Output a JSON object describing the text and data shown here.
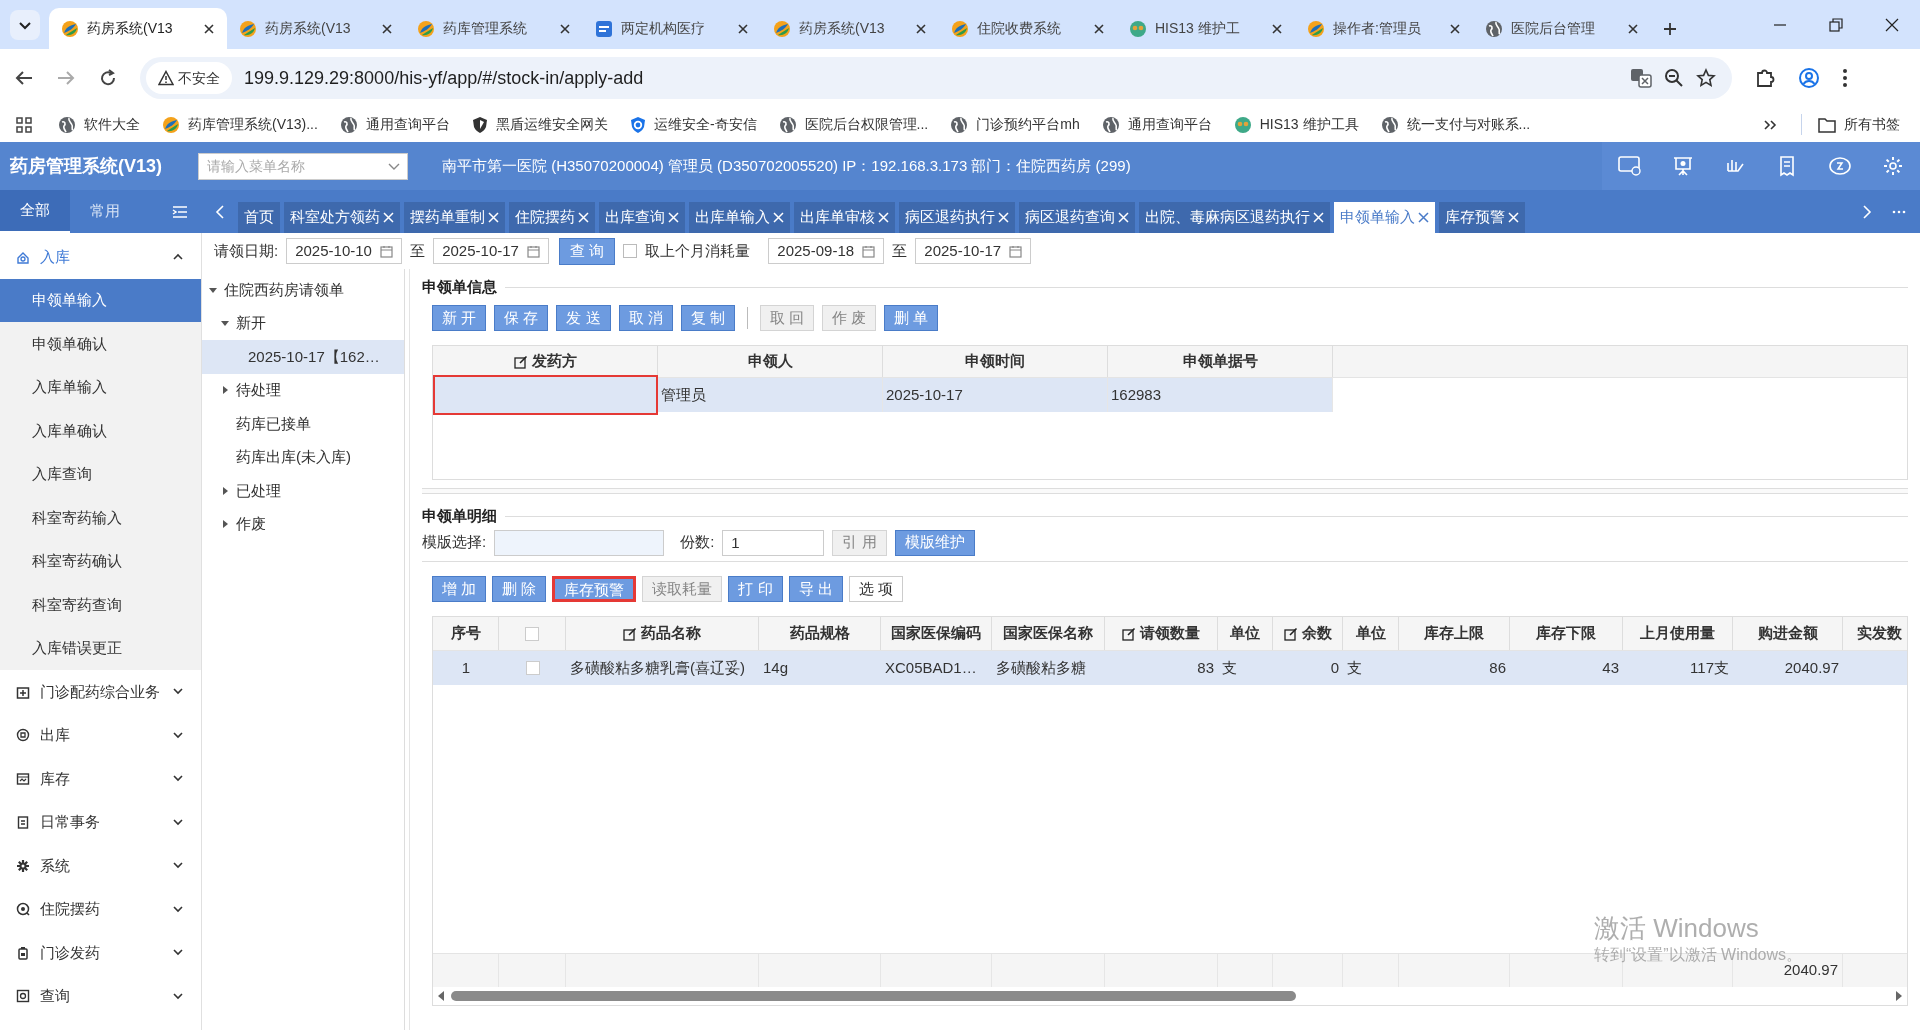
{
  "browser": {
    "tabs": [
      {
        "title": "药房系统(V13",
        "kind": "swirl",
        "selected": true
      },
      {
        "title": "药房系统(V13",
        "kind": "swirl",
        "selected": false
      },
      {
        "title": "药库管理系统",
        "kind": "swirl",
        "selected": false
      },
      {
        "title": "两定机构医疗",
        "kind": "chs",
        "selected": false
      },
      {
        "title": "药房系统(V13",
        "kind": "swirl",
        "selected": false
      },
      {
        "title": "住院收费系统",
        "kind": "swirl",
        "selected": false
      },
      {
        "title": "HIS13 维护工",
        "kind": "his",
        "selected": false
      },
      {
        "title": "操作者:管理员",
        "kind": "swirl",
        "selected": false
      },
      {
        "title": "医院后台管理",
        "kind": "globe",
        "selected": false
      }
    ],
    "security": "不安全",
    "url": "199.9.129.29:8000/his-yf/app/#/stock-in/apply-add",
    "bookmarks": [
      {
        "label": "软件大全",
        "kind": "globe"
      },
      {
        "label": "药库管理系统(V13)...",
        "kind": "swirl"
      },
      {
        "label": "通用查询平台",
        "kind": "globe"
      },
      {
        "label": "黑盾运维安全网关",
        "kind": "shield-dark"
      },
      {
        "label": "运维安全-奇安信",
        "kind": "shield"
      },
      {
        "label": "医院后台权限管理...",
        "kind": "globe"
      },
      {
        "label": "门诊预约平台mh",
        "kind": "globe"
      },
      {
        "label": "通用查询平台",
        "kind": "globe"
      },
      {
        "label": "HIS13 维护工具",
        "kind": "his"
      },
      {
        "label": "统一支付与对账系...",
        "kind": "globe"
      }
    ],
    "all_bookmarks": "所有书签"
  },
  "app": {
    "title": "药房管理系统(V13)",
    "menu_search": {
      "placeholder": "请输入菜单名称"
    },
    "info": "南平市第一医院 (H35070200004) 管理员 (D350702005520) IP：192.168.3.173 部门：住院西药房 (299)"
  },
  "sidebar": {
    "tabs": [
      {
        "label": "全部",
        "selected": true
      },
      {
        "label": "常用",
        "selected": false
      }
    ],
    "groups": [
      {
        "label": "入库",
        "kind": "inbox",
        "expanded": true,
        "children": [
          {
            "label": "申领单输入",
            "selected": true
          },
          {
            "label": "申领单确认",
            "selected": false
          },
          {
            "label": "入库单输入",
            "selected": false
          },
          {
            "label": "入库单确认",
            "selected": false
          },
          {
            "label": "入库查询",
            "selected": false
          },
          {
            "label": "科室寄药输入",
            "selected": false
          },
          {
            "label": "科室寄药确认",
            "selected": false
          },
          {
            "label": "科室寄药查询",
            "selected": false
          },
          {
            "label": "入库错误更正",
            "selected": false
          }
        ]
      },
      {
        "label": "门诊配药综合业务",
        "kind": "clinic",
        "expanded": false
      },
      {
        "label": "出库",
        "kind": "outbox",
        "expanded": false
      },
      {
        "label": "库存",
        "kind": "stock",
        "expanded": false
      },
      {
        "label": "日常事务",
        "kind": "daily",
        "expanded": false
      },
      {
        "label": "系统",
        "kind": "gear",
        "expanded": false
      },
      {
        "label": "住院摆药",
        "kind": "ward",
        "expanded": false
      },
      {
        "label": "门诊发药",
        "kind": "dispense",
        "expanded": false
      },
      {
        "label": "查询",
        "kind": "query",
        "expanded": false
      }
    ]
  },
  "page_tabs": [
    {
      "label": "首页",
      "closable": false,
      "selected": false
    },
    {
      "label": "科室处方领药",
      "closable": true,
      "selected": false
    },
    {
      "label": "摆药单重制",
      "closable": true,
      "selected": false
    },
    {
      "label": "住院摆药",
      "closable": true,
      "selected": false
    },
    {
      "label": "出库查询",
      "closable": true,
      "selected": false
    },
    {
      "label": "出库单输入",
      "closable": true,
      "selected": false
    },
    {
      "label": "出库单审核",
      "closable": true,
      "selected": false
    },
    {
      "label": "病区退药执行",
      "closable": true,
      "selected": false
    },
    {
      "label": "病区退药查询",
      "closable": true,
      "selected": false
    },
    {
      "label": "出院、毒麻病区退药执行",
      "closable": true,
      "selected": false
    },
    {
      "label": "申领单输入",
      "closable": true,
      "selected": true
    },
    {
      "label": "库存预警",
      "closable": true,
      "selected": false
    }
  ],
  "filter": {
    "label": "请领日期:",
    "from": "2025-10-10",
    "to_label": "至",
    "to": "2025-10-17",
    "query": "查 询",
    "checkbox": {
      "label": "取上个月消耗量",
      "checked": false
    },
    "from2": "2025-09-18",
    "to_label2": "至",
    "to2": "2025-10-17"
  },
  "tree": [
    {
      "label": "住院西药房请领单",
      "expanded": true,
      "selected": false,
      "children": [
        {
          "label": "新开",
          "expanded": true,
          "selected": false,
          "children": [
            {
              "label": "2025-10-17【162…",
              "selected": true
            }
          ]
        },
        {
          "label": "待处理",
          "expanded": false,
          "selected": false
        },
        {
          "label": "药库已接单",
          "selected": false
        },
        {
          "label": "药库出库(未入库)",
          "selected": false
        },
        {
          "label": "已处理",
          "expanded": false,
          "selected": false
        },
        {
          "label": "作废",
          "expanded": false,
          "selected": false
        }
      ]
    }
  ],
  "info_section": {
    "title": "申领单信息",
    "button_groups": [
      [
        {
          "label": "新 开",
          "disabled": false
        },
        {
          "label": "保 存",
          "disabled": false
        },
        {
          "label": "发 送",
          "disabled": false
        },
        {
          "label": "取 消",
          "disabled": false
        },
        {
          "label": "复 制",
          "disabled": false
        }
      ],
      [
        {
          "label": "取 回",
          "disabled": true
        },
        {
          "label": "作 废",
          "disabled": true
        },
        {
          "label": "删 单",
          "disabled": false
        }
      ]
    ],
    "table": {
      "columns": [
        {
          "label": "发药方",
          "editable": true
        },
        {
          "label": "申领人",
          "editable": false
        },
        {
          "label": "申领时间",
          "editable": false
        },
        {
          "label": "申领单据号",
          "editable": false
        }
      ],
      "rows": [
        {
          "selected": true,
          "cells": [
            {
              "highlighted": true
            },
            {
              "text": "管理员",
              "highlighted": false
            },
            {
              "text": "2025-10-17",
              "highlighted": false
            },
            {
              "text": "162983",
              "highlighted": false
            }
          ]
        }
      ]
    }
  },
  "detail_section": {
    "title": "申领单明细",
    "template": {
      "label": "模版选择:"
    },
    "copies": {
      "label": "份数:",
      "value": "1"
    },
    "template_buttons": [
      {
        "label": "引 用",
        "disabled": true,
        "highlighted": false
      },
      {
        "label": "模版维护",
        "disabled": false,
        "highlighted": false
      }
    ],
    "toolbar": [
      {
        "label": "增 加",
        "kind": "normal",
        "disabled": false,
        "highlighted": false
      },
      {
        "label": "删 除",
        "kind": "normal",
        "disabled": false,
        "highlighted": false
      },
      {
        "label": "库存预警",
        "kind": "normal",
        "disabled": false,
        "highlighted": true
      },
      {
        "label": "读取耗量",
        "kind": "normal",
        "disabled": true,
        "highlighted": false
      },
      {
        "label": "打 印",
        "kind": "normal",
        "disabled": false,
        "highlighted": false
      },
      {
        "label": "导 出",
        "kind": "normal",
        "disabled": false,
        "highlighted": false
      },
      {
        "label": "选 项",
        "kind": "plain",
        "disabled": false,
        "highlighted": false
      }
    ],
    "grid": {
      "columns": [
        {
          "label": "序号",
          "kind": "text",
          "editable": false
        },
        {
          "kind": "checkbox",
          "checked": false
        },
        {
          "label": "药品名称",
          "kind": "text",
          "editable": true
        },
        {
          "label": "药品规格",
          "kind": "text",
          "editable": false
        },
        {
          "label": "国家医保编码",
          "kind": "text",
          "editable": false
        },
        {
          "label": "国家医保名称",
          "kind": "text",
          "editable": false
        },
        {
          "label": "请领数量",
          "kind": "text",
          "editable": true
        },
        {
          "label": "单位",
          "kind": "text",
          "editable": false
        },
        {
          "label": "余数",
          "kind": "text",
          "editable": true
        },
        {
          "label": "单位",
          "kind": "text",
          "editable": false
        },
        {
          "label": "库存上限",
          "kind": "text",
          "editable": false
        },
        {
          "label": "库存下限",
          "kind": "text",
          "editable": false
        },
        {
          "label": "上月使用量",
          "kind": "text",
          "editable": false
        },
        {
          "label": "购进金额",
          "kind": "text",
          "editable": false,
          "total": "2040.97"
        },
        {
          "label": "实发数",
          "kind": "text",
          "editable": false
        }
      ],
      "rows": [
        {
          "selected": true,
          "checked": false,
          "cells": [
            "1",
            "",
            "多磺酸粘多糖乳膏(喜辽妥)",
            "14g",
            "XC05BAD1…",
            "多磺酸粘多糖",
            "83",
            "支",
            "0",
            "支",
            "86",
            "43",
            "117支",
            "2040.97"
          ]
        }
      ]
    }
  },
  "os_notice": {
    "title": "激活 Windows",
    "text": "转到“设置”以激活 Windows。"
  }
}
